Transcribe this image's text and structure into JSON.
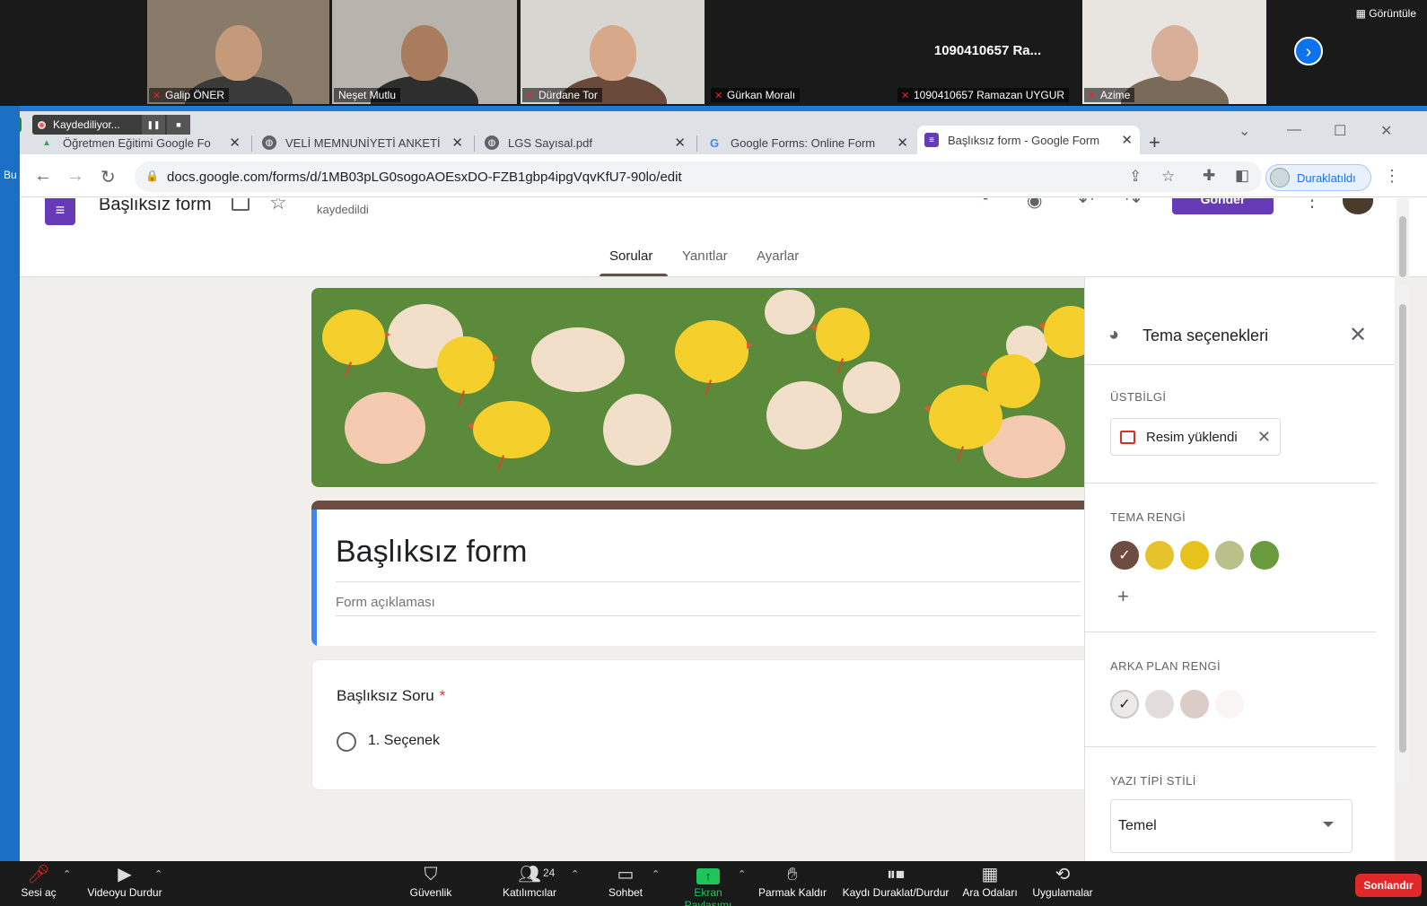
{
  "gallery": {
    "view_label": "Görüntüle",
    "tiles": [
      {
        "name": "Galip ÖNER",
        "bg": "#8a7a6a",
        "skin": "#c59a7a",
        "shirt": "#3a3a3a",
        "active": false
      },
      {
        "name": "Neşet Mutlu",
        "bg": "#b9b3ad",
        "skin": "#a87c5c",
        "shirt": "#2e2e2e",
        "active": true
      },
      {
        "name": "Dürdane Tor",
        "bg": "#d8d6d0",
        "skin": "#d8a88a",
        "shirt": "#6a4a3a",
        "active": false
      },
      {
        "name": "Azime",
        "bg": "#e8e4df",
        "skin": "#d8b09a",
        "shirt": "#7a6a5a",
        "active": false
      }
    ],
    "text_tile": {
      "big": "1090410657 Ra...",
      "name": "1090410657 Ramazan UYGUR"
    },
    "text_tile2": {
      "name": "Gürkan Moralı"
    }
  },
  "browser": {
    "recording": "Kaydediliyor...",
    "tabs": [
      {
        "label": "Öğretmen Eğitimi Google Fo",
        "icon_color": "#34a853"
      },
      {
        "label": "VELİ MEMNUNİYETİ ANKETİ",
        "icon_color": "#5f6368"
      },
      {
        "label": "LGS Sayısal.pdf",
        "icon_color": "#5f6368"
      },
      {
        "label": "Google Forms: Online Form",
        "icon_color": "#ffffff"
      },
      {
        "label": "Başlıksız form - Google Form",
        "icon_color": "#673ab7"
      }
    ],
    "url": "docs.google.com/forms/d/1MB03pLG0sogoAOEsxDO-FZB1gbp4ipgVqvKfU7-90lo/edit",
    "paused_label": "Duraklatıldı",
    "left_strip": "Bu"
  },
  "forms": {
    "doc_title": "Başlıksız form",
    "save_status": "kaydedildi",
    "send_label": "Gönder",
    "tabs": [
      "Sorular",
      "Yanıtlar",
      "Ayarlar"
    ],
    "form_title": "Başlıksız form",
    "form_desc": "Form açıklaması",
    "question_title": "Başlıksız Soru",
    "required_mark": "*",
    "option_label": "1. Seçenek",
    "accent": "#6d4c41"
  },
  "theme": {
    "title": "Tema seçenekleri",
    "header_label": "ÜSTBİLGİ",
    "image_chip": "Resim yüklendi",
    "theme_color_label": "TEMA RENGİ",
    "theme_colors": [
      "#6d4c41",
      "#e6c32c",
      "#e6c21a",
      "#b9c08a",
      "#6a9a3e"
    ],
    "bg_color_label": "ARKA PLAN RENGİ",
    "bg_colors": [
      "#ece9e6",
      "#e3dcdc",
      "#dcccc7",
      "#faf5f5"
    ],
    "font_label": "YAZI TİPİ STİLİ",
    "font_value": "Temel"
  },
  "zoom": {
    "buttons": [
      {
        "key": "mute",
        "label": "Sesi aç",
        "icon": "🎤"
      },
      {
        "key": "video",
        "label": "Videoyu Durdur",
        "icon": "📹"
      },
      {
        "key": "security",
        "label": "Güvenlik",
        "icon": "🛡"
      },
      {
        "key": "participants",
        "label": "Katılımcılar",
        "icon": "👥",
        "count": "24"
      },
      {
        "key": "chat",
        "label": "Sohbet",
        "icon": "💬"
      },
      {
        "key": "share",
        "label": "Ekran Paylaşımı",
        "icon": "↑"
      },
      {
        "key": "raise",
        "label": "Parmak Kaldır",
        "icon": "✋"
      },
      {
        "key": "record",
        "label": "Kaydı Duraklat/Durdur",
        "icon": "⏸⏹"
      },
      {
        "key": "breakout",
        "label": "Ara Odaları",
        "icon": "▦"
      },
      {
        "key": "apps",
        "label": "Uygulamalar",
        "icon": "⚙"
      }
    ],
    "end_label": "Sonlandır"
  }
}
